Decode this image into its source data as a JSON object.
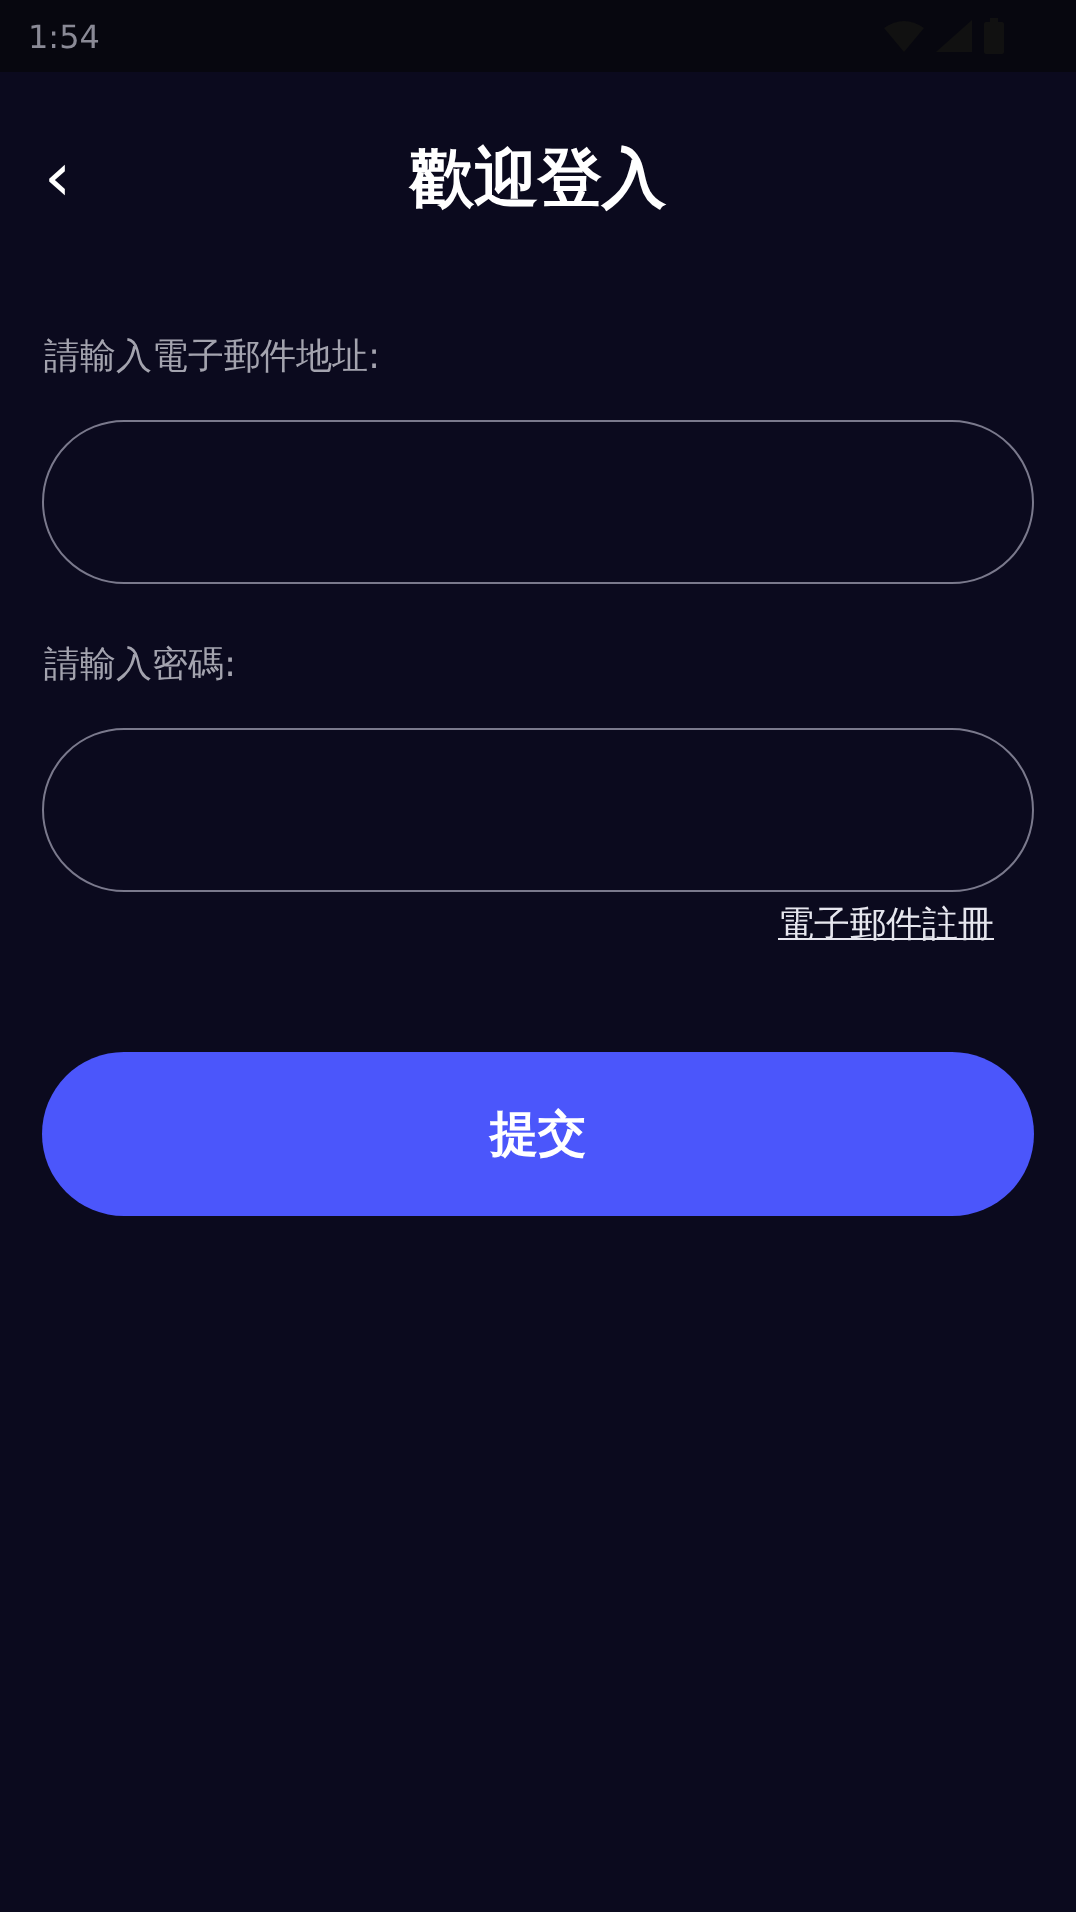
{
  "status_bar": {
    "time": "1:54"
  },
  "header": {
    "back_icon": "‹",
    "title": "歡迎登入"
  },
  "form": {
    "fields": [
      {
        "label": "請輸入電子郵件地址:"
      },
      {
        "label": "請輸入密碼:"
      }
    ],
    "register_link": "電子郵件註冊",
    "submit_button": "提交"
  }
}
